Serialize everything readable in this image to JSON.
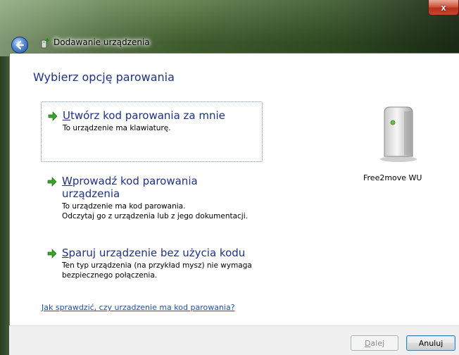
{
  "window": {
    "title": "Dodawanie urządzenia",
    "close_label": "x"
  },
  "heading": "Wybierz opcję parowania",
  "options": [
    {
      "accel": "U",
      "title_rest": "twórz kod parowania za mnie",
      "desc": [
        "To urządzenie ma klawiaturę."
      ]
    },
    {
      "accel": "W",
      "title_rest": "prowadź kod parowania urządzenia",
      "desc": [
        "To urządzenie ma kod parowania.",
        "Odczytaj go z urządzenia lub z jego dokumentacji."
      ]
    },
    {
      "accel": "S",
      "title_rest": "paruj urządzenie bez użycia kodu",
      "desc": [
        "Ten typ urządzenia (na przykład mysz) nie wymaga",
        "bezpiecznego połączenia."
      ]
    }
  ],
  "device": {
    "name": "Free2move WU",
    "icon": "bluetooth-device-icon"
  },
  "help_link": "Jak sprawdzić, czy urzadzenie ma kod parowania?",
  "buttons": {
    "next_accel": "D",
    "next_rest": "alej",
    "cancel": "Anuluj"
  },
  "colors": {
    "heading": "#1e3287",
    "link": "#1e50a2",
    "arrow": "#3aa32a"
  }
}
